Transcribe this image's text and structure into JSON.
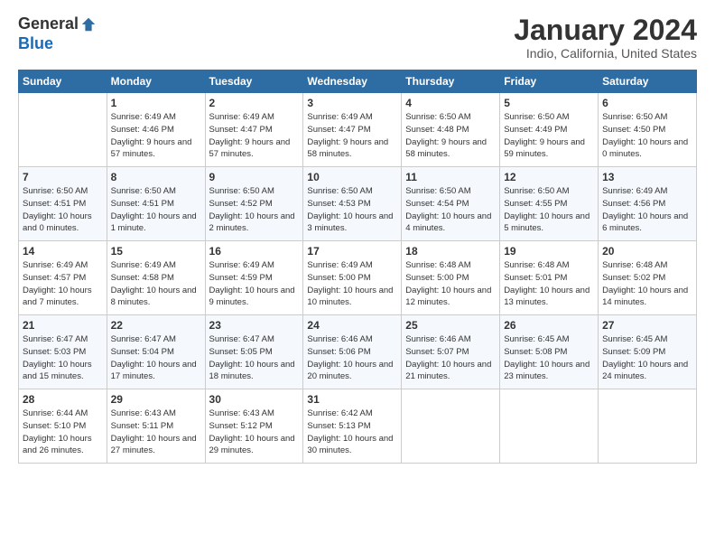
{
  "header": {
    "logo_line1": "General",
    "logo_line2": "Blue",
    "month_title": "January 2024",
    "location": "Indio, California, United States"
  },
  "days_of_week": [
    "Sunday",
    "Monday",
    "Tuesday",
    "Wednesday",
    "Thursday",
    "Friday",
    "Saturday"
  ],
  "weeks": [
    [
      {
        "day": "",
        "sunrise": "",
        "sunset": "",
        "daylight": ""
      },
      {
        "day": "1",
        "sunrise": "Sunrise: 6:49 AM",
        "sunset": "Sunset: 4:46 PM",
        "daylight": "Daylight: 9 hours and 57 minutes."
      },
      {
        "day": "2",
        "sunrise": "Sunrise: 6:49 AM",
        "sunset": "Sunset: 4:47 PM",
        "daylight": "Daylight: 9 hours and 57 minutes."
      },
      {
        "day": "3",
        "sunrise": "Sunrise: 6:49 AM",
        "sunset": "Sunset: 4:47 PM",
        "daylight": "Daylight: 9 hours and 58 minutes."
      },
      {
        "day": "4",
        "sunrise": "Sunrise: 6:50 AM",
        "sunset": "Sunset: 4:48 PM",
        "daylight": "Daylight: 9 hours and 58 minutes."
      },
      {
        "day": "5",
        "sunrise": "Sunrise: 6:50 AM",
        "sunset": "Sunset: 4:49 PM",
        "daylight": "Daylight: 9 hours and 59 minutes."
      },
      {
        "day": "6",
        "sunrise": "Sunrise: 6:50 AM",
        "sunset": "Sunset: 4:50 PM",
        "daylight": "Daylight: 10 hours and 0 minutes."
      }
    ],
    [
      {
        "day": "7",
        "sunrise": "Sunrise: 6:50 AM",
        "sunset": "Sunset: 4:51 PM",
        "daylight": "Daylight: 10 hours and 0 minutes."
      },
      {
        "day": "8",
        "sunrise": "Sunrise: 6:50 AM",
        "sunset": "Sunset: 4:51 PM",
        "daylight": "Daylight: 10 hours and 1 minute."
      },
      {
        "day": "9",
        "sunrise": "Sunrise: 6:50 AM",
        "sunset": "Sunset: 4:52 PM",
        "daylight": "Daylight: 10 hours and 2 minutes."
      },
      {
        "day": "10",
        "sunrise": "Sunrise: 6:50 AM",
        "sunset": "Sunset: 4:53 PM",
        "daylight": "Daylight: 10 hours and 3 minutes."
      },
      {
        "day": "11",
        "sunrise": "Sunrise: 6:50 AM",
        "sunset": "Sunset: 4:54 PM",
        "daylight": "Daylight: 10 hours and 4 minutes."
      },
      {
        "day": "12",
        "sunrise": "Sunrise: 6:50 AM",
        "sunset": "Sunset: 4:55 PM",
        "daylight": "Daylight: 10 hours and 5 minutes."
      },
      {
        "day": "13",
        "sunrise": "Sunrise: 6:49 AM",
        "sunset": "Sunset: 4:56 PM",
        "daylight": "Daylight: 10 hours and 6 minutes."
      }
    ],
    [
      {
        "day": "14",
        "sunrise": "Sunrise: 6:49 AM",
        "sunset": "Sunset: 4:57 PM",
        "daylight": "Daylight: 10 hours and 7 minutes."
      },
      {
        "day": "15",
        "sunrise": "Sunrise: 6:49 AM",
        "sunset": "Sunset: 4:58 PM",
        "daylight": "Daylight: 10 hours and 8 minutes."
      },
      {
        "day": "16",
        "sunrise": "Sunrise: 6:49 AM",
        "sunset": "Sunset: 4:59 PM",
        "daylight": "Daylight: 10 hours and 9 minutes."
      },
      {
        "day": "17",
        "sunrise": "Sunrise: 6:49 AM",
        "sunset": "Sunset: 5:00 PM",
        "daylight": "Daylight: 10 hours and 10 minutes."
      },
      {
        "day": "18",
        "sunrise": "Sunrise: 6:48 AM",
        "sunset": "Sunset: 5:00 PM",
        "daylight": "Daylight: 10 hours and 12 minutes."
      },
      {
        "day": "19",
        "sunrise": "Sunrise: 6:48 AM",
        "sunset": "Sunset: 5:01 PM",
        "daylight": "Daylight: 10 hours and 13 minutes."
      },
      {
        "day": "20",
        "sunrise": "Sunrise: 6:48 AM",
        "sunset": "Sunset: 5:02 PM",
        "daylight": "Daylight: 10 hours and 14 minutes."
      }
    ],
    [
      {
        "day": "21",
        "sunrise": "Sunrise: 6:47 AM",
        "sunset": "Sunset: 5:03 PM",
        "daylight": "Daylight: 10 hours and 15 minutes."
      },
      {
        "day": "22",
        "sunrise": "Sunrise: 6:47 AM",
        "sunset": "Sunset: 5:04 PM",
        "daylight": "Daylight: 10 hours and 17 minutes."
      },
      {
        "day": "23",
        "sunrise": "Sunrise: 6:47 AM",
        "sunset": "Sunset: 5:05 PM",
        "daylight": "Daylight: 10 hours and 18 minutes."
      },
      {
        "day": "24",
        "sunrise": "Sunrise: 6:46 AM",
        "sunset": "Sunset: 5:06 PM",
        "daylight": "Daylight: 10 hours and 20 minutes."
      },
      {
        "day": "25",
        "sunrise": "Sunrise: 6:46 AM",
        "sunset": "Sunset: 5:07 PM",
        "daylight": "Daylight: 10 hours and 21 minutes."
      },
      {
        "day": "26",
        "sunrise": "Sunrise: 6:45 AM",
        "sunset": "Sunset: 5:08 PM",
        "daylight": "Daylight: 10 hours and 23 minutes."
      },
      {
        "day": "27",
        "sunrise": "Sunrise: 6:45 AM",
        "sunset": "Sunset: 5:09 PM",
        "daylight": "Daylight: 10 hours and 24 minutes."
      }
    ],
    [
      {
        "day": "28",
        "sunrise": "Sunrise: 6:44 AM",
        "sunset": "Sunset: 5:10 PM",
        "daylight": "Daylight: 10 hours and 26 minutes."
      },
      {
        "day": "29",
        "sunrise": "Sunrise: 6:43 AM",
        "sunset": "Sunset: 5:11 PM",
        "daylight": "Daylight: 10 hours and 27 minutes."
      },
      {
        "day": "30",
        "sunrise": "Sunrise: 6:43 AM",
        "sunset": "Sunset: 5:12 PM",
        "daylight": "Daylight: 10 hours and 29 minutes."
      },
      {
        "day": "31",
        "sunrise": "Sunrise: 6:42 AM",
        "sunset": "Sunset: 5:13 PM",
        "daylight": "Daylight: 10 hours and 30 minutes."
      },
      {
        "day": "",
        "sunrise": "",
        "sunset": "",
        "daylight": ""
      },
      {
        "day": "",
        "sunrise": "",
        "sunset": "",
        "daylight": ""
      },
      {
        "day": "",
        "sunrise": "",
        "sunset": "",
        "daylight": ""
      }
    ]
  ]
}
